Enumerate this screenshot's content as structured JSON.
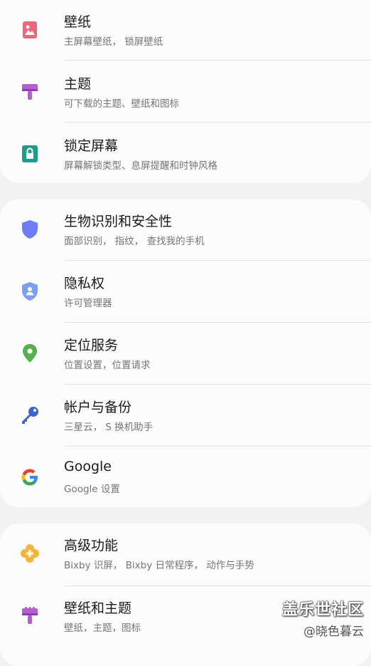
{
  "sections": [
    {
      "items": [
        {
          "title": "壁纸",
          "subtitle": "主屏幕壁纸， 锁屏壁纸",
          "icon": "wallpaper-icon"
        },
        {
          "title": "主题",
          "subtitle": "可下载的主题、壁纸和图标",
          "icon": "theme-brush-icon"
        },
        {
          "title": "锁定屏幕",
          "subtitle": "屏幕解锁类型、息屏提醒和时钟风格",
          "icon": "lock-icon"
        }
      ]
    },
    {
      "items": [
        {
          "title": "生物识别和安全性",
          "subtitle": "面部识别， 指纹， 查找我的手机",
          "icon": "shield-icon"
        },
        {
          "title": "隐私权",
          "subtitle": "许可管理器",
          "icon": "privacy-shield-icon"
        },
        {
          "title": "定位服务",
          "subtitle": "位置设置，位置请求",
          "icon": "location-pin-icon"
        },
        {
          "title": "帐户与备份",
          "subtitle": "三星云， S 换机助手",
          "icon": "key-icon"
        },
        {
          "title": "Google",
          "subtitle": "Google 设置",
          "icon": "google-icon"
        }
      ]
    },
    {
      "items": [
        {
          "title": "高级功能",
          "subtitle": "Bixby 识屏， Bixby 日常程序， 动作与手势",
          "icon": "advanced-features-icon"
        },
        {
          "title": "壁纸和主题",
          "subtitle": "壁纸，主题，图标",
          "icon": "wallpaper-theme-brush-icon"
        }
      ]
    }
  ],
  "watermark": {
    "main": "盖乐世社区",
    "sub": "@晓色暮云"
  },
  "colors": {
    "wallpaper": "#e9677f",
    "theme": "#b35fd0",
    "lock": "#1e9e8a",
    "biometrics": "#6f7cf5",
    "privacy": "#7ba0f2",
    "location": "#56b04e",
    "accounts": "#3f64c9",
    "advanced": "#f5b43c"
  }
}
